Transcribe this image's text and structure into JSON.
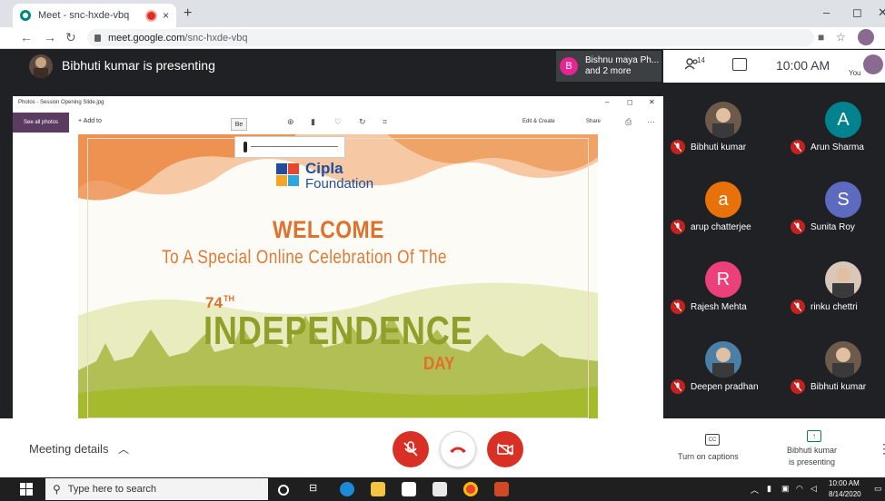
{
  "browser": {
    "tab_title": "Meet - snc-hxde-vbq",
    "tab_close": "×",
    "new_tab": "+",
    "url_host": "meet.google.com",
    "url_path": "/snc-hxde-vbq",
    "window_controls": [
      "–",
      "◻",
      "✕"
    ]
  },
  "meet_top": {
    "presenting_text": "Bibhuti kumar is presenting",
    "raise": {
      "initial": "B",
      "line1": "Bishnu maya Ph...",
      "line2": "and 2 more"
    },
    "people_count": "14",
    "clock": "10:00 AM",
    "you_label": "You"
  },
  "photos": {
    "title": "Photos - Session Opening Slide.jpg",
    "see_all": "See all photos",
    "add_to": "+ Add to",
    "edit_create": "Edit & Create",
    "share": "Share",
    "tooltip": "Be",
    "window_controls": [
      "–",
      "◻",
      "✕"
    ]
  },
  "slide": {
    "logo_line1": "Cipla",
    "logo_line2": "Foundation",
    "welcome": "WELCOME",
    "subtitle": "To A Special Online Celebration Of The",
    "number": "74",
    "suffix": "TH",
    "main": "INDEPENDENCE",
    "day": "DAY"
  },
  "participants": [
    {
      "name": "Bibhuti kumar",
      "initial": "",
      "color": "#6d5a4b",
      "photo": true
    },
    {
      "name": "Arun Sharma",
      "initial": "A",
      "color": "#00838f",
      "photo": false
    },
    {
      "name": "arup chatterjee",
      "initial": "a",
      "color": "#e8710a",
      "photo": false
    },
    {
      "name": "Sunita Roy",
      "initial": "S",
      "color": "#5c6bc0",
      "photo": false
    },
    {
      "name": "Rajesh Mehta",
      "initial": "R",
      "color": "#ec407a",
      "photo": false
    },
    {
      "name": "rinku chettri",
      "initial": "",
      "color": "#d9c7b8",
      "photo": true
    },
    {
      "name": "Deepen pradhan",
      "initial": "",
      "color": "#4a7fa8",
      "photo": true
    },
    {
      "name": "Bibhuti kumar",
      "initial": "",
      "color": "#6d5a4b",
      "photo": true
    }
  ],
  "bottom": {
    "meeting_details": "Meeting details",
    "captions_label": "Turn on captions",
    "cc_icon_text": "CC",
    "presenting_line1": "Bibhuti kumar",
    "presenting_line2": "is presenting",
    "colors": {
      "danger": "#d93025",
      "accent": "#0b8043"
    }
  },
  "taskbar": {
    "search_placeholder": "Type here to search",
    "time": "10:00 AM",
    "date": "8/14/2020"
  }
}
